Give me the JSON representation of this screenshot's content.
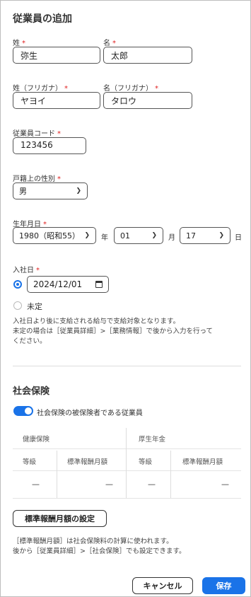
{
  "header": {
    "title": "従業員の追加"
  },
  "name": {
    "last_label": "姓",
    "last_value": "弥生",
    "first_label": "名",
    "first_value": "太郎",
    "required_mark": "*"
  },
  "kana": {
    "last_label": "姓（フリガナ）",
    "last_value": "ヤヨイ",
    "first_label": "名（フリガナ）",
    "first_value": "タロウ"
  },
  "code": {
    "label": "従業員コード",
    "value": "123456"
  },
  "gender": {
    "label": "戸籍上の性別",
    "value": "男"
  },
  "birth": {
    "label": "生年月日",
    "year": "1980（昭和55）",
    "year_unit": "年",
    "month": "01",
    "month_unit": "月",
    "day": "17",
    "day_unit": "日"
  },
  "join": {
    "label": "入社日",
    "date_value": "2024/12/01",
    "undecided_label": "未定",
    "note_line1": "入社日より後に支給される給与で支給対象となります。",
    "note_line2": "未定の場合は［従業員詳細］>［業務情報］で後から入力を行って",
    "note_line3": "ください。"
  },
  "insurance": {
    "title": "社会保険",
    "toggle_label": "社会保険の被保険者である従業員",
    "health_header": "健康保険",
    "pension_header": "厚生年金",
    "grade_label": "等級",
    "monthly_label": "標準報酬月額",
    "dash": "—",
    "set_button": "標準報酬月額の設定",
    "note_line1": "［標準報酬月額］は社会保険料の計算に使われます。",
    "note_line2": "後から［従業員詳細］>［社会保険］でも設定できます。"
  },
  "footer": {
    "cancel": "キャンセル",
    "save": "保存"
  },
  "colors": {
    "accent": "#1a73e8",
    "required": "#e02020"
  }
}
